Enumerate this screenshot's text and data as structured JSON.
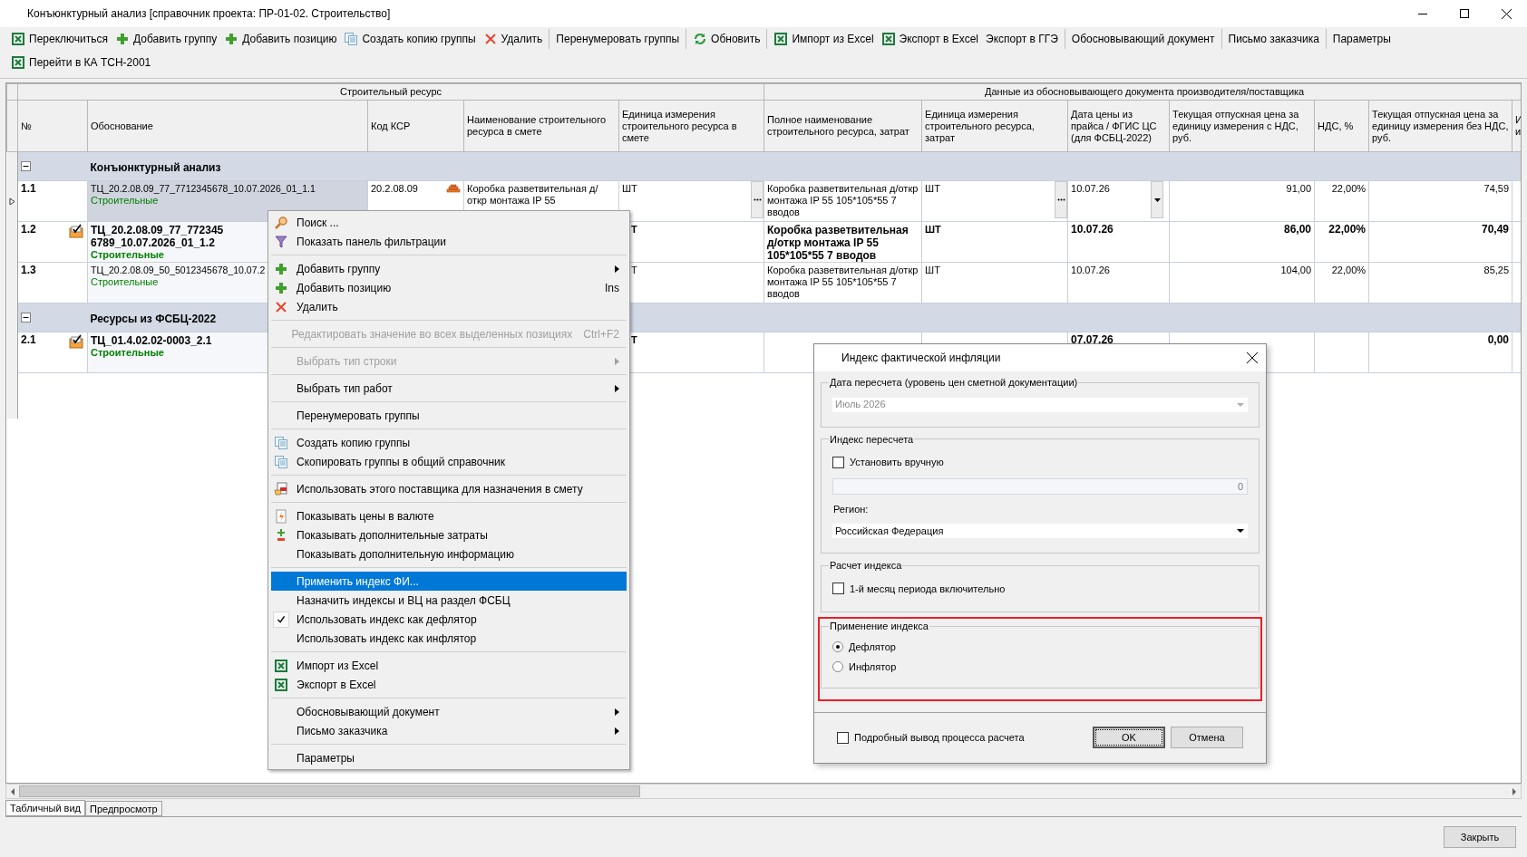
{
  "window": {
    "title": "Конъюнктурный анализ [справочник проекта: ПР-01-02. Строительство]"
  },
  "toolbar": {
    "rows": [
      [
        [
          {
            "label": "Переключиться",
            "kind": "excel"
          },
          {
            "label": "Добавить группу",
            "kind": "add"
          },
          {
            "label": "Добавить позицию",
            "kind": "add"
          },
          {
            "label": "Создать копию группы",
            "kind": "copy"
          },
          {
            "label": "Удалить",
            "kind": "delete"
          }
        ],
        [
          {
            "label": "Перенумеровать группы",
            "kind": "text"
          }
        ],
        [
          {
            "label": "Обновить",
            "kind": "refresh"
          }
        ],
        [
          {
            "label": "Импорт из Excel",
            "kind": "excel"
          },
          {
            "label": "Экспорт в Excel",
            "kind": "excel"
          },
          {
            "label": "Экспорт в ГГЭ",
            "kind": "text"
          }
        ],
        [
          {
            "label": "Обосновывающий документ",
            "kind": "text"
          }
        ],
        [
          {
            "label": "Письмо заказчика",
            "kind": "text"
          }
        ],
        [
          {
            "label": "Параметры",
            "kind": "text"
          }
        ]
      ],
      [
        [
          {
            "label": "Перейти в КА ТСН-2001",
            "kind": "excel"
          }
        ]
      ]
    ]
  },
  "table": {
    "column_groups": [
      {
        "label": "Строительный ресурс",
        "columns": [
          "№",
          "Обоснование",
          "Код КСР",
          "Наименование строительного ресурса в смете",
          "Единица измерения строительного ресурса в смете"
        ]
      },
      {
        "label": "Данные из обосновывающего документа производителя/поставщика",
        "columns": [
          "Полное наименование строительного ресурса, затрат",
          "Единица измерения строительного ресурса, затрат",
          "Дата цены из прайса / ФГИС ЦС (для ФСБЦ-2022)",
          "Текущая отпускная цена за единицу измерения с НДС, руб.",
          "НДС, %",
          "Текущая отпускная цена за единицу измерения без НДС, руб.",
          "И и"
        ]
      }
    ],
    "groups": [
      {
        "title": "Конъюнктурный анализ",
        "expanded": true,
        "rows": [
          {
            "number": "1.1",
            "current": true,
            "bold": false,
            "marked": false,
            "unit_cut": false,
            "justification": "ТЦ_20.2.08.09_77_7712345678_10.07.2026_01_1.1",
            "category": "Строительные",
            "ksr_code": "20.2.08.09",
            "name": "Коробка разветвительная д/откр монтажа IP 55",
            "unit": "ШТ",
            "full_name": "Коробка разветвительная д/откр монтажа IP 55 105*105*55 7 вводов",
            "supplier_unit": "ШТ",
            "price_date": "10.07.26",
            "price_with_vat": "91,00",
            "vat": "22,00%",
            "price_without_vat": "74,59"
          },
          {
            "number": "1.2",
            "current": false,
            "bold": true,
            "marked": true,
            "unit_cut": true,
            "justification": "ТЦ_20.2.08.09_77_7723456789_10.07.2026_01_1.2",
            "category": "Строительные",
            "unit": "Т",
            "full_name": "Коробка разветвительная д/откр монтажа IP 55 105*105*55 7 вводов",
            "supplier_unit": "ШТ",
            "price_date": "10.07.26",
            "price_with_vat": "86,00",
            "vat": "22,00%",
            "price_without_vat": "70,49"
          },
          {
            "number": "1.3",
            "current": false,
            "bold": false,
            "marked": false,
            "unit_cut": true,
            "justification": "ТЦ_20.2.08.09_50_5012345678_10.07.2",
            "category": "Строительные",
            "unit": "Т",
            "full_name": "Коробка разветвительная д/откр монтажа IP 55 105*105*55 7 вводов",
            "supplier_unit": "ШТ",
            "price_date": "10.07.26",
            "price_with_vat": "104,00",
            "vat": "22,00%",
            "price_without_vat": "85,25"
          }
        ]
      },
      {
        "title": "Ресурсы из ФСБЦ-2022",
        "expanded": true,
        "rows": [
          {
            "number": "2.1",
            "current": false,
            "bold": true,
            "marked": true,
            "unit_cut": true,
            "justification": "ТЦ_01.4.02.02-0003_2.1",
            "category": "Строительные",
            "unit": "Т",
            "price_date": "07.07.26",
            "price_without_vat": "0,00"
          }
        ]
      }
    ]
  },
  "context_menu": {
    "groups": [
      {
        "items": [
          {
            "label": "Поиск ...",
            "kind": "search",
            "disabled": false,
            "selected": false,
            "checked": false,
            "submenu": false
          },
          {
            "label": "Показать панель фильтрации",
            "kind": "filter",
            "disabled": false,
            "selected": false,
            "checked": false,
            "submenu": false
          }
        ]
      },
      {
        "items": [
          {
            "label": "Добавить группу",
            "kind": "add",
            "disabled": false,
            "selected": false,
            "checked": false,
            "submenu": true
          },
          {
            "label": "Добавить позицию",
            "kind": "add",
            "shortcut": "Ins",
            "disabled": false,
            "selected": false,
            "checked": false,
            "submenu": false
          },
          {
            "label": "Удалить",
            "kind": "delete",
            "disabled": false,
            "selected": false,
            "checked": false,
            "submenu": false
          }
        ]
      },
      {
        "items": [
          {
            "label": "Редактировать значение во всех выделенных позициях",
            "kind": "text",
            "shortcut": "Ctrl+F2",
            "disabled": true,
            "selected": false,
            "checked": false,
            "submenu": false
          }
        ]
      },
      {
        "items": [
          {
            "label": "Выбрать тип строки",
            "kind": "text",
            "disabled": true,
            "selected": false,
            "checked": false,
            "submenu": true
          }
        ]
      },
      {
        "items": [
          {
            "label": "Выбрать тип работ",
            "kind": "text",
            "disabled": false,
            "selected": false,
            "checked": false,
            "submenu": true
          }
        ]
      },
      {
        "items": [
          {
            "label": "Перенумеровать группы",
            "kind": "text",
            "disabled": false,
            "selected": false,
            "checked": false,
            "submenu": false
          }
        ]
      },
      {
        "items": [
          {
            "label": "Создать копию группы",
            "kind": "copy",
            "disabled": false,
            "selected": false,
            "checked": false,
            "submenu": false
          },
          {
            "label": "Скопировать группы в общий справочник",
            "kind": "copy",
            "disabled": false,
            "selected": false,
            "checked": false,
            "submenu": false
          }
        ]
      },
      {
        "items": [
          {
            "label": "Использовать этого поставщика для назначения в смету",
            "kind": "supplier",
            "disabled": false,
            "selected": false,
            "checked": false,
            "submenu": false
          }
        ]
      },
      {
        "items": [
          {
            "label": "Показывать цены в валюте",
            "kind": "currency",
            "disabled": false,
            "selected": false,
            "checked": false,
            "submenu": false
          },
          {
            "label": "Показывать дополнительные затраты",
            "kind": "costs",
            "disabled": false,
            "selected": false,
            "checked": false,
            "submenu": false
          },
          {
            "label": "Показывать дополнительную информацию",
            "kind": "text",
            "disabled": false,
            "selected": false,
            "checked": false,
            "submenu": false
          }
        ]
      },
      {
        "items": [
          {
            "label": "Применить индекс ФИ...",
            "kind": "text",
            "disabled": false,
            "selected": true,
            "checked": false,
            "submenu": false
          },
          {
            "label": "Назначить индексы и ВЦ на раздел ФСБЦ",
            "kind": "text",
            "disabled": false,
            "selected": false,
            "checked": false,
            "submenu": false
          },
          {
            "label": "Использовать индекс как дефлятор",
            "kind": "text",
            "disabled": false,
            "selected": false,
            "checked": true,
            "submenu": false
          },
          {
            "label": "Использовать индекс как инфлятор",
            "kind": "text",
            "disabled": false,
            "selected": false,
            "checked": false,
            "submenu": false
          }
        ]
      },
      {
        "items": [
          {
            "label": "Импорт из Excel",
            "kind": "excel",
            "disabled": false,
            "selected": false,
            "checked": false,
            "submenu": false
          },
          {
            "label": "Экспорт в Excel",
            "kind": "excel",
            "disabled": false,
            "selected": false,
            "checked": false,
            "submenu": false
          }
        ]
      },
      {
        "items": [
          {
            "label": "Обосновывающий документ",
            "kind": "text",
            "disabled": false,
            "selected": false,
            "checked": false,
            "submenu": true
          },
          {
            "label": "Письмо заказчика",
            "kind": "text",
            "disabled": false,
            "selected": false,
            "checked": false,
            "submenu": true
          }
        ]
      },
      {
        "items": [
          {
            "label": "Параметры",
            "kind": "text",
            "disabled": false,
            "selected": false,
            "checked": false,
            "submenu": false
          }
        ]
      }
    ]
  },
  "dialog": {
    "title": "Индекс фактической инфляции",
    "sections": [
      {
        "label": "Дата пересчета (уровень цен сметной документации)",
        "highlighted": false,
        "controls": [
          {
            "kind": "combo",
            "value": "Июль 2026",
            "disabled": true
          }
        ]
      },
      {
        "label": "Индекс пересчета",
        "highlighted": false,
        "controls": [
          {
            "kind": "checkbox",
            "label": "Установить вручную",
            "checked": false
          },
          {
            "kind": "number",
            "value": "0",
            "disabled": true
          },
          {
            "kind": "label",
            "text": "Регион:"
          },
          {
            "kind": "combo",
            "value": "Российская Федерация",
            "disabled": false
          }
        ]
      },
      {
        "label": "Расчет индекса",
        "highlighted": false,
        "controls": [
          {
            "kind": "checkbox",
            "label": "1-й месяц периода включительно",
            "checked": false
          }
        ]
      },
      {
        "label": "Применение индекса",
        "highlighted": true,
        "controls": [
          {
            "kind": "radio",
            "label": "Дефлятор",
            "selected": true
          },
          {
            "kind": "radio",
            "label": "Инфлятор",
            "selected": false
          }
        ]
      }
    ],
    "footer_checkbox": {
      "label": "Подробный вывод процесса расчета",
      "checked": false
    },
    "buttons": [
      {
        "label": "OK",
        "default": true
      },
      {
        "label": "Отмена",
        "default": false
      }
    ]
  },
  "view_tabs": [
    {
      "label": "Табличный вид",
      "selected": true
    },
    {
      "label": "Предпросмотр",
      "selected": false
    }
  ],
  "close_button": "Закрыть"
}
